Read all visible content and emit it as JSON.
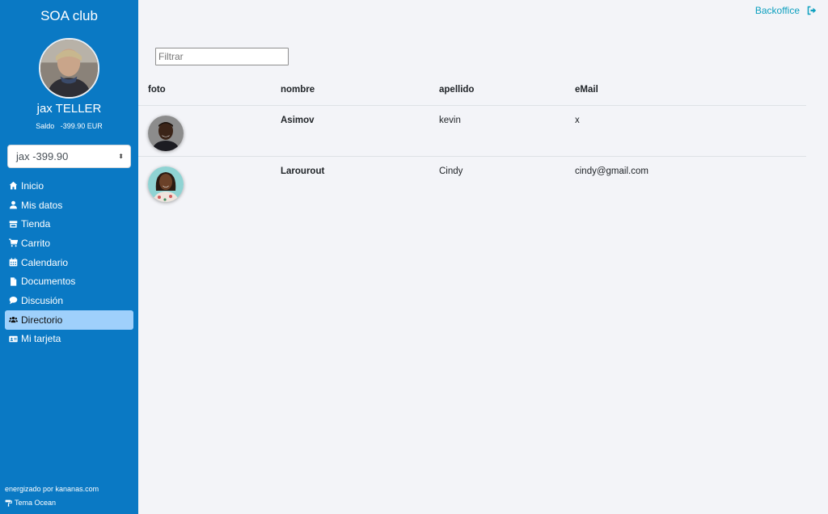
{
  "sidebar": {
    "brand": "SOA club",
    "user_name": "jax TELLER",
    "balance_label": "Saldo",
    "balance_value": "-399.90 EUR",
    "account_select": {
      "value": "jax -399.90",
      "caret": "⬍"
    },
    "items": [
      {
        "label": "Inicio",
        "icon": "home-icon",
        "active": false
      },
      {
        "label": "Mis datos",
        "icon": "user-icon",
        "active": false
      },
      {
        "label": "Tienda",
        "icon": "store-icon",
        "active": false
      },
      {
        "label": "Carrito",
        "icon": "cart-icon",
        "active": false
      },
      {
        "label": "Calendario",
        "icon": "calendar-icon",
        "active": false
      },
      {
        "label": "Documentos",
        "icon": "document-icon",
        "active": false
      },
      {
        "label": "Discusión",
        "icon": "comment-icon",
        "active": false
      },
      {
        "label": "Directorio",
        "icon": "users-icon",
        "active": true
      },
      {
        "label": "Mi tarjeta",
        "icon": "id-card-icon",
        "active": false
      }
    ],
    "powered_by": "energizado por kananas.com",
    "theme": "Tema Ocean"
  },
  "header": {
    "backoffice_label": "Backoffice",
    "logout_icon": "sign-out-icon"
  },
  "filter": {
    "placeholder": "Filtrar",
    "value": ""
  },
  "table": {
    "columns": [
      "foto",
      "nombre",
      "apellido",
      "eMail"
    ],
    "rows": [
      {
        "nombre": "Asimov",
        "apellido": "kevin",
        "email": "x"
      },
      {
        "nombre": "Larourout",
        "apellido": "Cindy",
        "email": "cindy@gmail.com"
      }
    ]
  },
  "colors": {
    "sidebar_bg": "#0a79c4",
    "active_item_bg": "#9fd0fb",
    "link": "#0ea0bf",
    "page_bg": "#f3f4f8"
  }
}
